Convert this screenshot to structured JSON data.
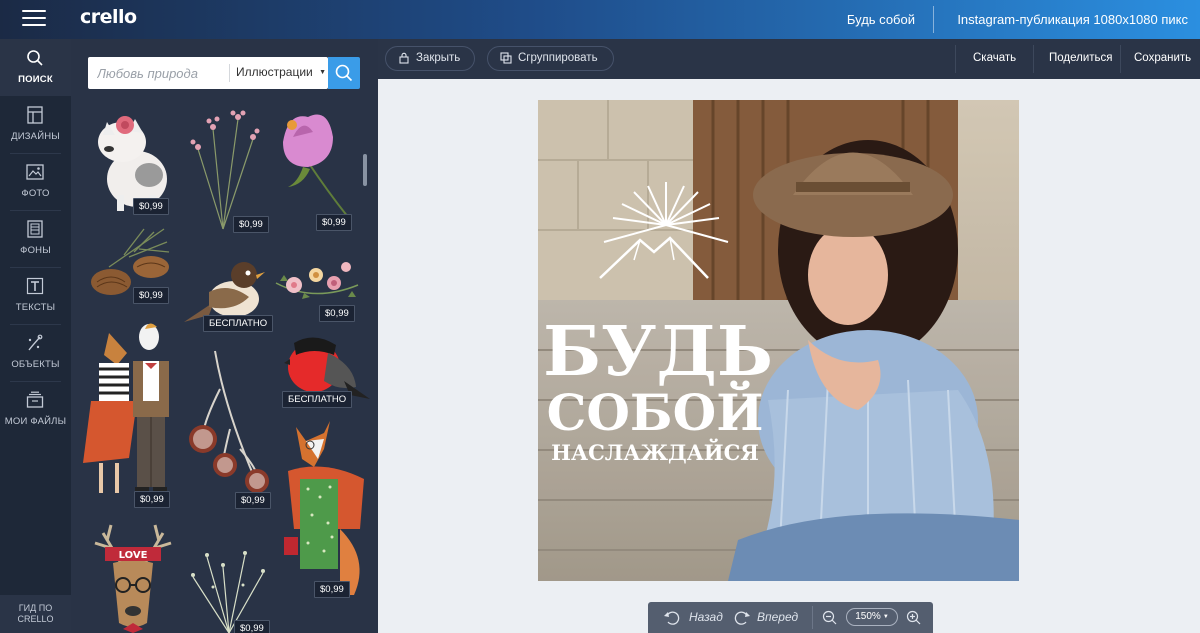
{
  "app": {
    "logo": "crello"
  },
  "header": {
    "doc_title": "Будь собой",
    "doc_size": "Instagram-публикация 1080x1080 пикс"
  },
  "rail": {
    "items": [
      {
        "label": "ПОИСК",
        "icon": "search-icon"
      },
      {
        "label": "ДИЗАЙНЫ",
        "icon": "designs-icon"
      },
      {
        "label": "ФОТО",
        "icon": "photo-icon"
      },
      {
        "label": "ФОНЫ",
        "icon": "backgrounds-icon"
      },
      {
        "label": "ТЕКСТЫ",
        "icon": "text-icon"
      },
      {
        "label": "ОБЪЕКТЫ",
        "icon": "objects-icon"
      },
      {
        "label": "МОИ ФАЙЛЫ",
        "icon": "my-files-icon"
      }
    ],
    "guide_line1": "ГИД ПО",
    "guide_line2": "CRELLO"
  },
  "library": {
    "search_placeholder": "Любовь природа",
    "category": "Иллюстрации",
    "items": [
      {
        "name": "bulldog",
        "price": "$0,99"
      },
      {
        "name": "dry-flowers",
        "price": "$0,99"
      },
      {
        "name": "pink-flower",
        "price": "$0,99"
      },
      {
        "name": "pine-cones",
        "price": "$0,99"
      },
      {
        "name": "sparrow",
        "price": "БЕСПЛАТНО"
      },
      {
        "name": "flower-garland",
        "price": "$0,99"
      },
      {
        "name": "animal-couple",
        "price": "$0,99"
      },
      {
        "name": "berry-branch",
        "price": "$0,99"
      },
      {
        "name": "bullfinch",
        "price": "БЕСПЛАТНО"
      },
      {
        "name": "fox-lady",
        "price": "$0,99"
      },
      {
        "name": "love-deer",
        "price": ""
      },
      {
        "name": "twigs",
        "price": "$0,99"
      }
    ],
    "deer_banner": "LOVE"
  },
  "toolbar": {
    "close": "Закрыть",
    "group": "Сгруппировать",
    "download": "Скачать",
    "share": "Поделиться",
    "save": "Сохранить"
  },
  "design": {
    "line1": "БУДЬ",
    "line2": "СОБОЙ",
    "line3": "НАСЛАЖДАЙСЯ"
  },
  "bottom": {
    "undo": "Назад",
    "redo": "Вперед",
    "zoom": "150%"
  },
  "colors": {
    "accent": "#3a9ce8",
    "panel": "#293346",
    "rail": "#1e2838"
  }
}
